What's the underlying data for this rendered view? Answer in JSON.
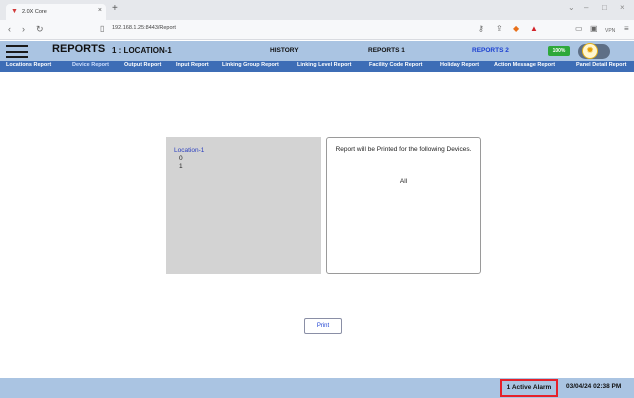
{
  "browser": {
    "tab_title": "2.0X Core",
    "tab_favicon": "app-favicon",
    "new_tab": "+",
    "close": "×",
    "url": "192.168.1.25:8443/Report",
    "window_controls": [
      "⌄",
      "–",
      "□",
      "×"
    ],
    "vpn_label": "VPN"
  },
  "header": {
    "title": "REPORTS",
    "location": "1 : LOCATION-1",
    "history": "HISTORY",
    "report1": "REPORTS 1",
    "report2": "REPORTS 2",
    "battery": "100%",
    "accent": "#1b3fd1"
  },
  "report_nav": [
    "Locations Report",
    "Device Report",
    "Output Report",
    "Input Report",
    "Linking Group Report",
    "Linking Level Report",
    "Facility Code Report",
    "Holiday Report",
    "Action Message Report",
    "Panel Detail Report"
  ],
  "tree": {
    "location": "Location-1",
    "devices": [
      "0",
      "1"
    ]
  },
  "info": {
    "message": "Report will be Printed for the following Devices.",
    "scope": "All"
  },
  "print_label": "Print",
  "footer": {
    "alarm": "1 Active Alarm",
    "datetime": "03/04/24 02:38 PM"
  }
}
